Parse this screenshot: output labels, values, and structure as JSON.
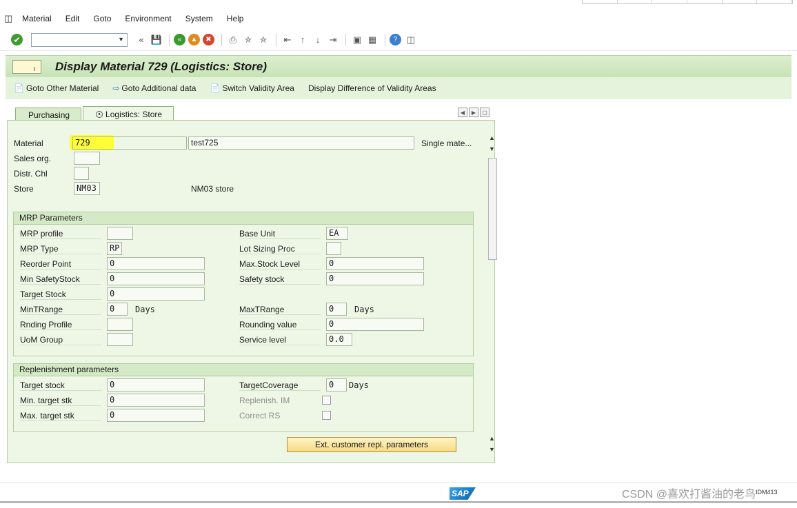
{
  "menu": [
    "Material",
    "Edit",
    "Goto",
    "Environment",
    "System",
    "Help"
  ],
  "menu_underline": [
    "M",
    "E",
    "G",
    "n",
    "S",
    "H"
  ],
  "toolbar": {
    "command_field_value": "",
    "back_label": "«"
  },
  "title": "Display Material 729 (Logistics: Store)",
  "app_toolbar": {
    "goto_other_material": "Goto Other Material",
    "goto_additional_data": "Goto Additional data",
    "switch_validity_area": "Switch Validity Area",
    "display_difference": "Display Difference of Validity Areas"
  },
  "tabs": {
    "purchasing": "Purchasing",
    "logistics_store": "Logistics: Store"
  },
  "header_fields": {
    "material_label": "Material",
    "material_value": "729",
    "material_desc": "test725",
    "material_type": "Single mate...",
    "sales_org_label": "Sales org.",
    "sales_org_value": "",
    "distr_chl_label": "Distr. Chl",
    "distr_chl_value": "",
    "store_label": "Store",
    "store_value": "NM03",
    "store_desc": "NM03 store"
  },
  "mrp": {
    "title": "MRP Parameters",
    "mrp_profile_label": "MRP profile",
    "mrp_profile_value": "",
    "mrp_type_label": "MRP Type",
    "mrp_type_value": "RP",
    "reorder_point_label": "Reorder Point",
    "reorder_point_value": "0",
    "min_safety_label": "Min SafetyStock",
    "min_safety_value": "0",
    "target_stock_label": "Target Stock",
    "target_stock_value": "0",
    "min_trange_label": "MinTRange",
    "min_trange_value": "0",
    "min_trange_unit": "Days",
    "rnd_profile_label": "Rnding Profile",
    "rnd_profile_value": "",
    "uom_group_label": "UoM Group",
    "uom_group_value": "",
    "base_unit_label": "Base Unit",
    "base_unit_value": "EA",
    "lot_sizing_label": "Lot Sizing Proc",
    "lot_sizing_value": "",
    "max_stock_label": "Max.Stock Level",
    "max_stock_value": "0",
    "safety_stock_label": "Safety stock",
    "safety_stock_value": "0",
    "max_trange_label": "MaxTRange",
    "max_trange_value": "0",
    "max_trange_unit": "Days",
    "rounding_value_label": "Rounding value",
    "rounding_value_value": "0",
    "service_level_label": "Service level",
    "service_level_value": "0.0"
  },
  "replenishment": {
    "title": "Replenishment parameters",
    "target_stock_label": "Target stock",
    "target_stock_value": "0",
    "min_target_label": "Min. target stk",
    "min_target_value": "0",
    "max_target_label": "Max. target stk",
    "max_target_value": "0",
    "target_coverage_label": "TargetCoverage",
    "target_coverage_value": "0",
    "target_coverage_unit": "Days",
    "replenish_im_label": "Replenish. IM",
    "replenish_im_checked": false,
    "correct_rs_label": "Correct RS",
    "correct_rs_checked": false
  },
  "ext_button": "Ext. customer repl. parameters",
  "status": {
    "sap_logo": "SAP",
    "system": "IDM413",
    "watermark": "CSDN @喜欢打酱油的老鸟"
  }
}
